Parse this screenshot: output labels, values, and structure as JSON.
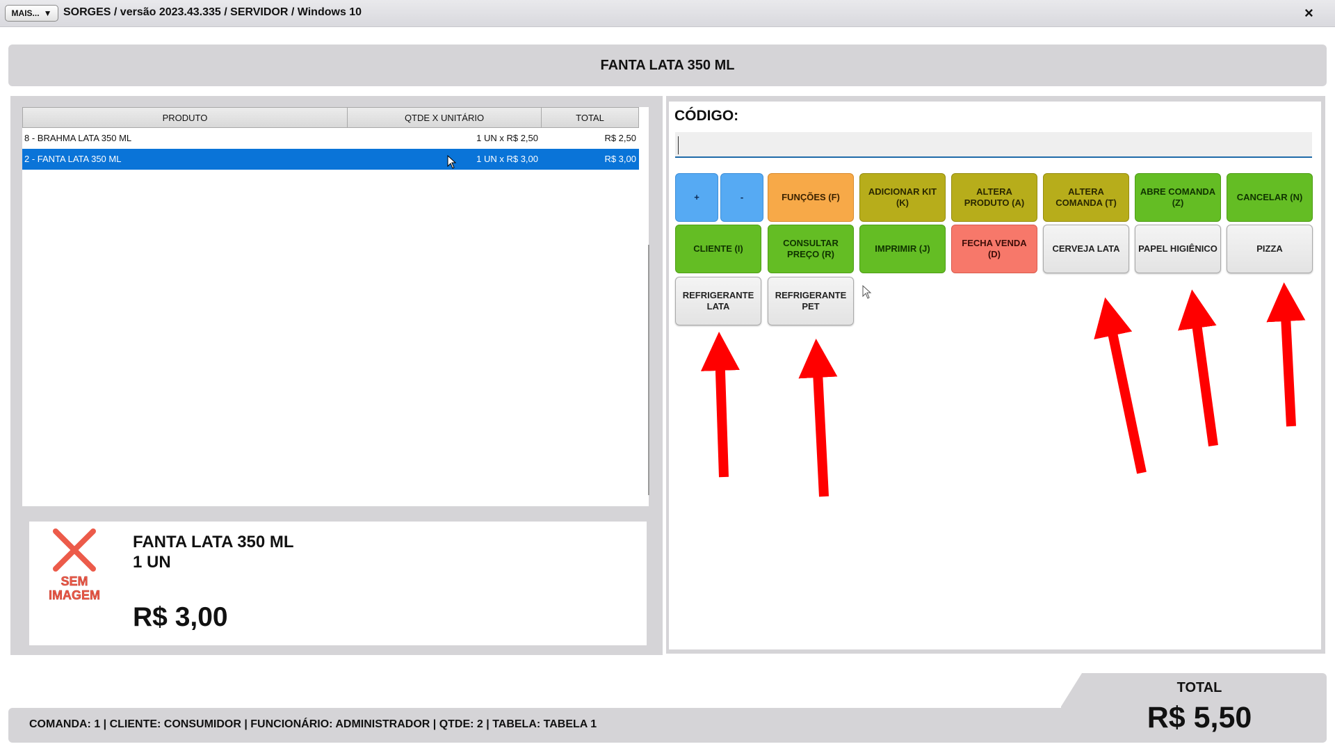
{
  "window": {
    "menu_button": "MAIS...",
    "menu_arrow": "▼",
    "title": "SORGES / versão 2023.43.335 / SERVIDOR / Windows 10",
    "close_icon": "×"
  },
  "banner": {
    "product": "FANTA LATA 350 ML"
  },
  "table": {
    "headers": [
      "PRODUTO",
      "QTDE X UNITÁRIO",
      "TOTAL"
    ],
    "rows": [
      {
        "produto": "8 - BRAHMA LATA 350 ML",
        "qtde": "1 UN x R$ 2,50",
        "total": "R$ 2,50",
        "selected": false
      },
      {
        "produto": "2 - FANTA LATA 350 ML",
        "qtde": "1 UN x R$ 3,00",
        "total": "R$ 3,00",
        "selected": true
      }
    ]
  },
  "info": {
    "no_image_line1": "SEM",
    "no_image_line2": "IMAGEM",
    "name": "FANTA LATA 350 ML",
    "qty": "1  UN",
    "price": "R$ 3,00"
  },
  "codigo": {
    "label": "CÓDIGO:",
    "value": ""
  },
  "buttons": [
    {
      "label": "+",
      "color": "blue"
    },
    {
      "label": "-",
      "color": "blue"
    },
    {
      "label": "FUNÇÕES (F)",
      "color": "orange"
    },
    {
      "label": "ADICIONAR KIT (K)",
      "color": "olive"
    },
    {
      "label": "ALTERA PRODUTO (A)",
      "color": "olive"
    },
    {
      "label": "ALTERA COMANDA (T)",
      "color": "olive"
    },
    {
      "label": "ABRE COMANDA (Z)",
      "color": "green"
    },
    {
      "label": "CANCELAR (N)",
      "color": "green"
    },
    {
      "label": "CLIENTE (I)",
      "color": "green"
    },
    {
      "label": "CONSULTAR PREÇO (R)",
      "color": "green"
    },
    {
      "label": "IMPRIMIR (J)",
      "color": "green"
    },
    {
      "label": "FECHA VENDA (D)",
      "color": "red"
    },
    {
      "label": "CERVEJA LATA",
      "color": "gray"
    },
    {
      "label": "PAPEL HIGIÊNICO",
      "color": "gray"
    },
    {
      "label": "PIZZA",
      "color": "gray"
    },
    {
      "label": "REFRIGERANTE LATA",
      "color": "gray"
    },
    {
      "label": "REFRIGERANTE PET",
      "color": "gray"
    }
  ],
  "status": {
    "text": "COMANDA: 1  |  CLIENTE: CONSUMIDOR  |  FUNCIONÁRIO: ADMINISTRADOR  |  QTDE: 2  |  TABELA: TABELA 1"
  },
  "total": {
    "label": "TOTAL",
    "value": "R$ 5,50"
  },
  "colors": {
    "selected_row": "#0a74d8",
    "panel": "#d5d4d7",
    "arrow": "#ff0000"
  }
}
